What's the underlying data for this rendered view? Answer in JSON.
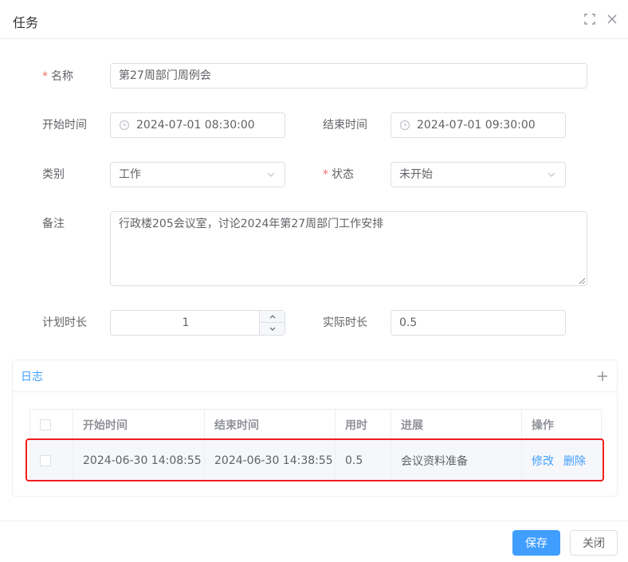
{
  "dialog": {
    "title": "任务"
  },
  "form": {
    "name": {
      "label": "名称",
      "required_mark": "*",
      "value": "第27周部门周例会"
    },
    "start_time": {
      "label": "开始时间",
      "value": "2024-07-01 08:30:00"
    },
    "end_time": {
      "label": "结束时间",
      "value": "2024-07-01 09:30:00"
    },
    "category": {
      "label": "类别",
      "value": "工作"
    },
    "status": {
      "label": "状态",
      "required_mark": "*",
      "value": "未开始"
    },
    "remark": {
      "label": "备注",
      "value": "行政楼205会议室，讨论2024年第27周部门工作安排"
    },
    "planned_duration": {
      "label": "计划时长",
      "value": "1"
    },
    "actual_duration": {
      "label": "实际时长",
      "value": "0.5"
    }
  },
  "log": {
    "title": "日志",
    "columns": [
      "开始时间",
      "结束时间",
      "用时",
      "进展",
      "操作"
    ],
    "rows": [
      {
        "start": "2024-06-30 14:08:55",
        "end": "2024-06-30 14:38:55",
        "duration": "0.5",
        "progress": "会议资料准备",
        "edit": "修改",
        "delete": "删除"
      }
    ]
  },
  "footer": {
    "save": "保存",
    "close": "关闭"
  },
  "colors": {
    "primary": "#409eff",
    "required": "#f56c6c",
    "highlight": "#f01e1e"
  },
  "icons": {
    "fullscreen": "fullscreen-icon",
    "close": "close-icon",
    "clock": "clock-icon",
    "chevron": "chevron-down-icon",
    "plus": "plus-icon"
  }
}
